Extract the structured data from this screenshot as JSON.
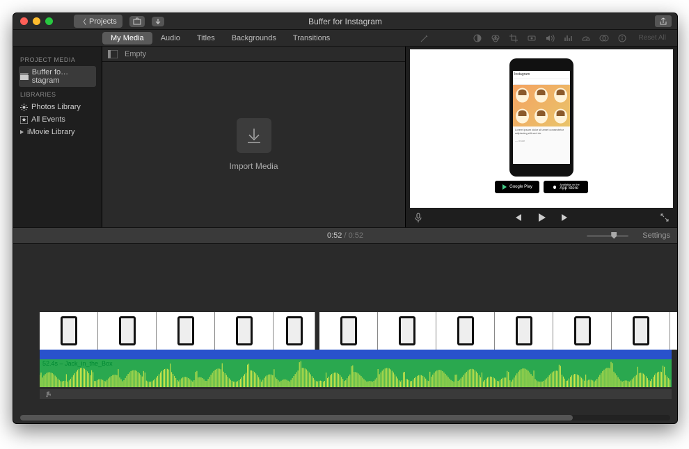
{
  "window": {
    "title": "Buffer for Instagram"
  },
  "toolbar": {
    "projects_btn": "Projects",
    "share_btn": "Share"
  },
  "tabs": {
    "items": [
      "My Media",
      "Audio",
      "Titles",
      "Backgrounds",
      "Transitions"
    ],
    "active_index": 0
  },
  "adjust_icons": [
    "color-balance-icon",
    "color-correct-icon",
    "crop-icon",
    "stabilize-icon",
    "volume-icon",
    "noise-icon",
    "speed-icon",
    "clip-filter-icon",
    "info-icon"
  ],
  "reset_label": "Reset All",
  "sidebar": {
    "heading1": "PROJECT MEDIA",
    "project_item": "Buffer fo…stagram",
    "heading2": "LIBRARIES",
    "lib_items": [
      "Photos Library",
      "All Events",
      "iMovie Library"
    ]
  },
  "browser": {
    "toggle_label": "Empty",
    "import_label": "Import Media"
  },
  "viewer": {
    "ig_title": "Instagram",
    "store1": "Google Play",
    "store2": "App Store",
    "store2_pre": "Available on the"
  },
  "time": {
    "current": "0:52",
    "total": "0:52",
    "settings_label": "Settings"
  },
  "timeline": {
    "video_clip_count_seg1": 5,
    "video_clip_count_seg2": 7,
    "audio_label": "52.4s – Jack_in_the_Box"
  }
}
